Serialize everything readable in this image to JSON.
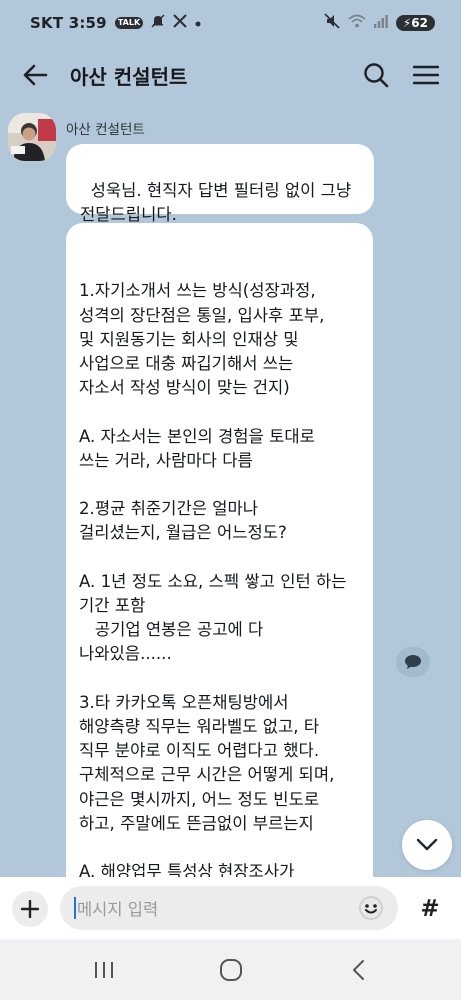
{
  "status_bar": {
    "carrier": "SKT",
    "time": "3:59",
    "notification_icons": [
      "talk-notification-icon",
      "bell-muted-icon",
      "x-app-icon",
      "dot-icon"
    ],
    "right_icons": [
      "mute-icon",
      "wifi-icon",
      "signal-icon"
    ],
    "battery": "62"
  },
  "header": {
    "title": "아산 컨설턴트",
    "icons": [
      "back-arrow-icon",
      "search-icon",
      "menu-icon"
    ]
  },
  "chat": {
    "sender_name": "아산 컨설턴트",
    "messages": [
      {
        "text": "성욱님. 현직자 답변 필터링 없이 그냥\n전달드립니다."
      },
      {
        "text": "1.자기소개서 쓰는 방식(성장과정,\n성격의 장단점은 통일, 입사후 포부,\n및 지원동기는 회사의 인재상 및\n사업으로 대충 짜깁기해서 쓰는\n자소서 작성 방식이 맞는 건지)\n\nA. 자소서는 본인의 경험을 토대로\n쓰는 거라, 사람마다 다름\n\n2.평균 취준기간은 얼마나\n걸리셨는지, 월급은 어느정도?\n\nA. 1년 정도 소요, 스펙 쌓고 인턴 하는\n기간 포함\n   공기업 연봉은 공고에 다\n나와있음......\n\n3.타 카카오톡 오픈채팅방에서\n해양측량 직무는 워라벨도 없고, 타\n직무 분야로 이직도 어렵다고 했다.\n구체적으로 근무 시간은 어떻게 되며,\n야근은 몇시까지, 어느 정도 빈도로\n하고, 주말에도 뜬금없이 부르는지\n\nA. 해양업무 특성상 현장조사가"
      }
    ]
  },
  "input_bar": {
    "placeholder": "메시지 입력",
    "hash_label": "#"
  },
  "colors": {
    "chat_background": "#b2c7d9",
    "bubble": "#ffffff",
    "input_field": "#ececec",
    "nav_bar": "#f1f1f3"
  }
}
